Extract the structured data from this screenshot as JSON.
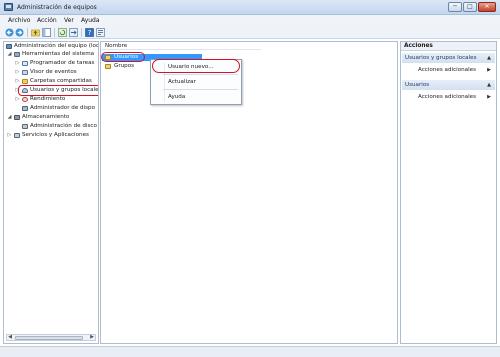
{
  "window": {
    "title": "Administración de equipos"
  },
  "menu": [
    "Archivo",
    "Acción",
    "Ver",
    "Ayuda"
  ],
  "tree": {
    "items": [
      "Administración del equipo (loc",
      "Herramientas del sistema",
      "Programador de tareas",
      "Visor de eventos",
      "Carpetas compartidas",
      "Usuarios y grupos locale",
      "Rendimiento",
      "Administrador de dispo",
      "Almacenamiento",
      "Administración de disco",
      "Servicios y Aplicaciones"
    ]
  },
  "list": {
    "column_header": "Nombre",
    "rows": [
      "Usuarios",
      "Grupos"
    ]
  },
  "context_menu": {
    "items": [
      "Usuario nuevo...",
      "Actualizar",
      "Ayuda"
    ]
  },
  "actions": {
    "header": "Acciones",
    "sections": [
      {
        "title": "Usuarios y grupos locales",
        "item": "Acciones adicionales"
      },
      {
        "title": "Usuarios",
        "item": "Acciones adicionales"
      }
    ]
  },
  "colors": {
    "highlight_oval": "#d0152b",
    "selection": "#3399ff",
    "titlebar": "#c3d6ee"
  },
  "icons": {
    "minimize": "minimize-icon",
    "maximize": "maximize-icon",
    "close": "close-icon"
  }
}
